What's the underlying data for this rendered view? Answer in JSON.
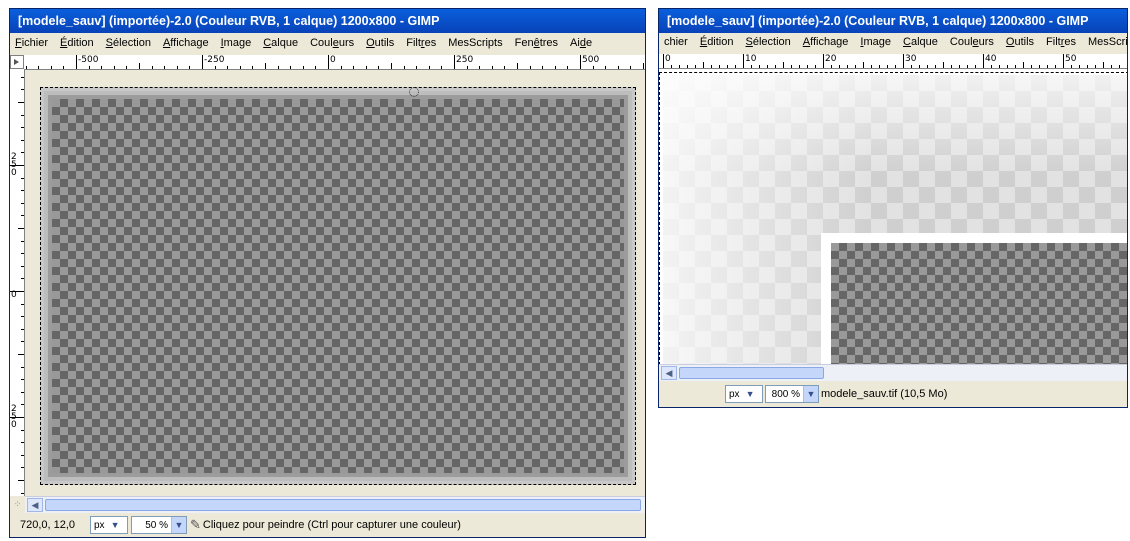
{
  "window1": {
    "title": "[modele_sauv] (importée)-2.0 (Couleur RVB, 1 calque) 1200x800 - GIMP",
    "menu": [
      {
        "pre": "",
        "u": "F",
        "post": "ichier"
      },
      {
        "pre": "",
        "u": "É",
        "post": "dition"
      },
      {
        "pre": "",
        "u": "S",
        "post": "élection"
      },
      {
        "pre": "",
        "u": "A",
        "post": "ffichage"
      },
      {
        "pre": "",
        "u": "I",
        "post": "mage"
      },
      {
        "pre": "",
        "u": "C",
        "post": "alque"
      },
      {
        "pre": "Coul",
        "u": "e",
        "post": "urs"
      },
      {
        "pre": "",
        "u": "O",
        "post": "utils"
      },
      {
        "pre": "Filt",
        "u": "r",
        "post": "es"
      },
      {
        "pre": "MesScripts",
        "u": "",
        "post": ""
      },
      {
        "pre": "Fen",
        "u": "ê",
        "post": "tres"
      },
      {
        "pre": "Ai",
        "u": "d",
        "post": "e"
      }
    ],
    "hruler_labels": [
      "-500",
      "-250",
      "0",
      "250",
      "500"
    ],
    "vruler_labels": [
      "250",
      "0",
      "250"
    ],
    "status": {
      "coords": "720,0, 12,0",
      "unit": "px",
      "zoom": "50 %",
      "message": "Cliquez pour peindre (Ctrl pour capturer une couleur)"
    }
  },
  "window2": {
    "title": "[modele_sauv] (importée)-2.0 (Couleur RVB, 1 calque) 1200x800 - GIMP",
    "menu": [
      {
        "pre": "chier",
        "u": "",
        "post": ""
      },
      {
        "pre": "",
        "u": "É",
        "post": "dition"
      },
      {
        "pre": "",
        "u": "S",
        "post": "élection"
      },
      {
        "pre": "",
        "u": "A",
        "post": "ffichage"
      },
      {
        "pre": "",
        "u": "I",
        "post": "mage"
      },
      {
        "pre": "",
        "u": "C",
        "post": "alque"
      },
      {
        "pre": "Coul",
        "u": "e",
        "post": "urs"
      },
      {
        "pre": "",
        "u": "O",
        "post": "utils"
      },
      {
        "pre": "Filt",
        "u": "r",
        "post": "es"
      },
      {
        "pre": "MesScri",
        "u": "",
        "post": ""
      }
    ],
    "hruler_labels": [
      "0",
      "10",
      "20",
      "30",
      "40",
      "50"
    ],
    "status": {
      "unit": "px",
      "zoom": "800 %",
      "message": "modele_sauv.tif (10,5 Mo)"
    }
  }
}
